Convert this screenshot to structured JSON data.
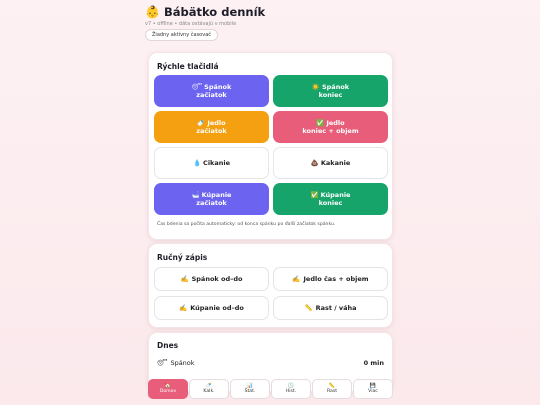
{
  "header": {
    "icon": "baby-icon",
    "title": "Bábätko denník",
    "subtitle": "v7 • offline • dáta ostávajú v mobile",
    "timer_status": "Žiadny aktívny časovač"
  },
  "quick": {
    "title": "Rýchle tlačidlá",
    "buttons": [
      {
        "icon": "😴",
        "line1": "Spánok",
        "line2": "začiatok",
        "color": "#6c63f0"
      },
      {
        "icon": "☀️",
        "line1": "Spánok",
        "line2": "koniec",
        "color": "#16a46b"
      },
      {
        "icon": "🍼",
        "line1": "Jedlo",
        "line2": "začiatok",
        "color": "#f4a010"
      },
      {
        "icon": "✅",
        "line1": "Jedlo",
        "line2": "koniec + objem",
        "color": "#e85d7a"
      },
      {
        "icon": "💧",
        "line1": "Cikanie",
        "line2": ""
      },
      {
        "icon": "💩",
        "line1": "Kakanie",
        "line2": ""
      },
      {
        "icon": "🛁",
        "line1": "Kúpanie",
        "line2": "začiatok",
        "color": "#6c63f0"
      },
      {
        "icon": "✅",
        "line1": "Kúpanie",
        "line2": "koniec",
        "color": "#16a46b"
      }
    ],
    "note": "Čas bdenia sa počíta automaticky: od konca spánku po ďalší začiatok spánku."
  },
  "manual": {
    "title": "Ručný zápis",
    "buttons": [
      {
        "icon": "✍️",
        "label": "Spánok od–do"
      },
      {
        "icon": "✍️",
        "label": "Jedlo čas + objem"
      },
      {
        "icon": "✍️",
        "label": "Kúpanie od–do"
      },
      {
        "icon": "📏",
        "label": "Rast / váha"
      }
    ]
  },
  "today": {
    "title": "Dnes",
    "rows": [
      {
        "icon": "😴",
        "label": "Spánok",
        "value": "0 min"
      }
    ]
  },
  "nav": [
    {
      "icon": "🏠",
      "label": "Domov",
      "active": true
    },
    {
      "icon": "🍼",
      "label": "Kalk."
    },
    {
      "icon": "📊",
      "label": "Štat."
    },
    {
      "icon": "🕒",
      "label": "Hist."
    },
    {
      "icon": "📏",
      "label": "Rast"
    },
    {
      "icon": "💾",
      "label": "Viac"
    }
  ]
}
